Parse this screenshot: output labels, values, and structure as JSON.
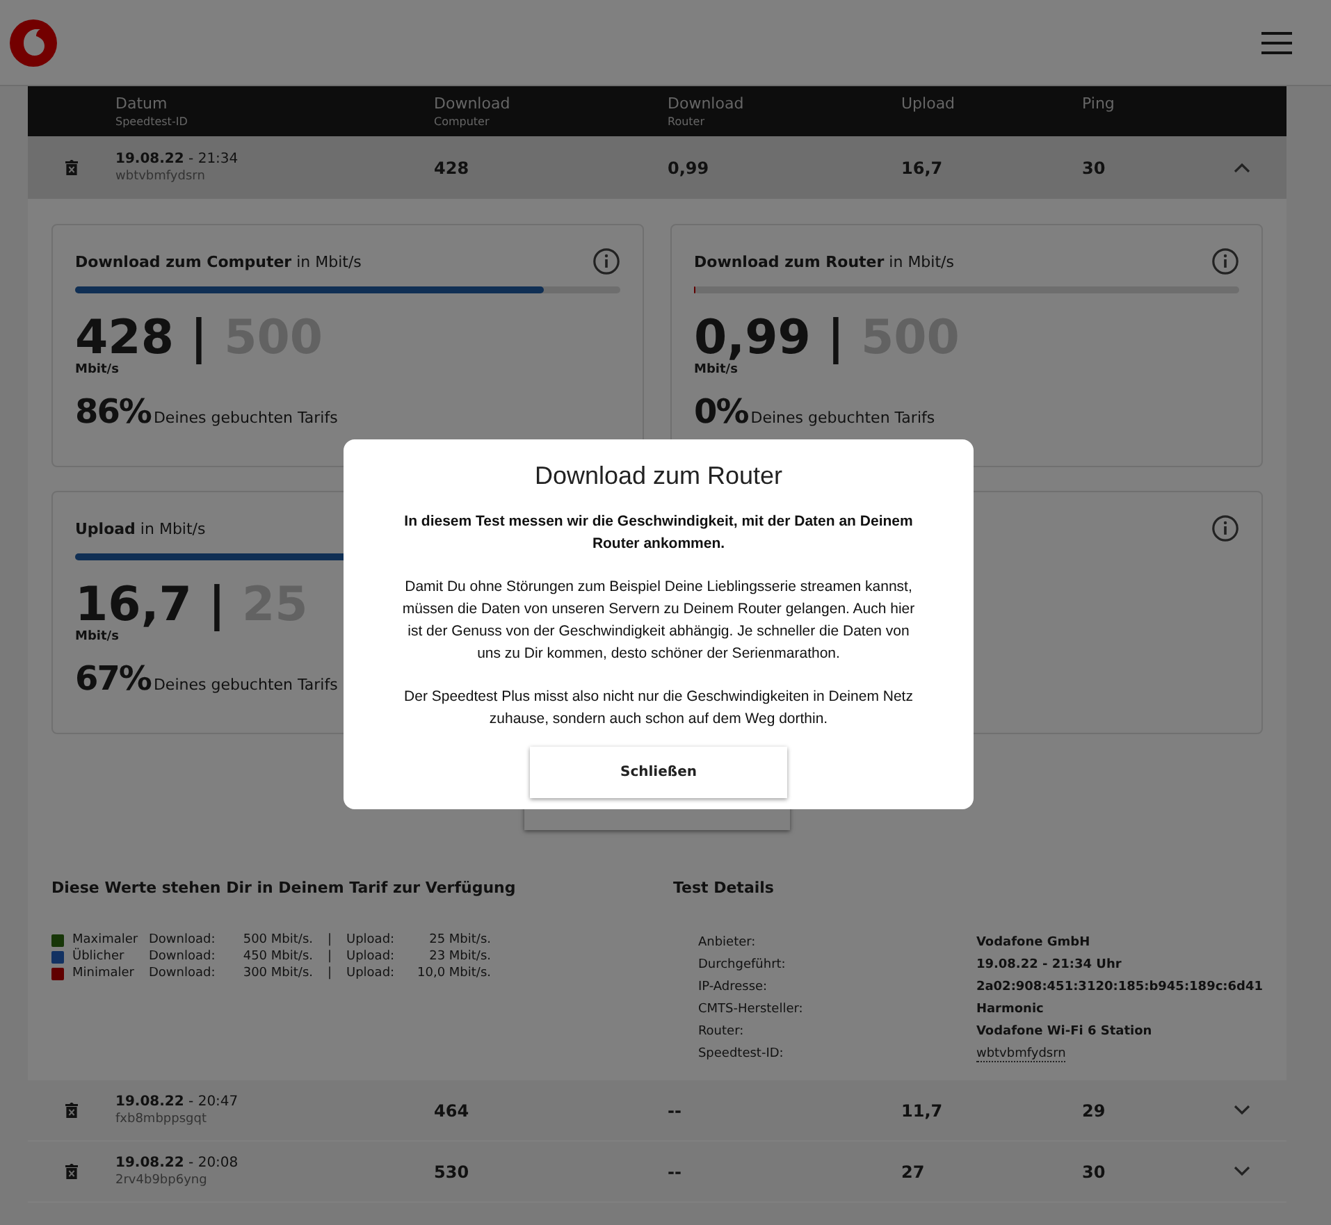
{
  "table": {
    "columns": [
      {
        "title": "Datum",
        "subtitle": "Speedtest-ID"
      },
      {
        "title": "Download",
        "subtitle": "Computer"
      },
      {
        "title": "Download",
        "subtitle": "Router"
      },
      {
        "title": "Upload"
      },
      {
        "title": "Ping"
      }
    ],
    "rows": [
      {
        "date": "19.08.22",
        "time": " - 21:34",
        "id": "wbtvbmfydsrn",
        "download_computer": "428",
        "download_router": "0,99",
        "upload": "16,7",
        "ping": "30",
        "expanded": true
      },
      {
        "date": "19.08.22",
        "time": " - 20:47",
        "id": "fxb8mbppsgqt",
        "download_computer": "464",
        "download_router": "--",
        "upload": "11,7",
        "ping": "29",
        "expanded": false
      },
      {
        "date": "19.08.22",
        "time": " - 20:08",
        "id": "2rv4b9bp6yng",
        "download_computer": "530",
        "download_router": "--",
        "upload": "27",
        "ping": "30",
        "expanded": false
      }
    ]
  },
  "cards": [
    {
      "title": "Download zum Computer",
      "unit_title": " in Mbit/s",
      "value": "428",
      "separator": " | ",
      "max": "500",
      "unit": "Mbit/s",
      "percent": "86%",
      "percent_label": "Deines gebuchten Tarifs",
      "level": 0.86,
      "color": "#102f54",
      "info": true
    },
    {
      "title": "Download zum Router",
      "unit_title": " in Mbit/s",
      "value": "0,99",
      "separator": " | ",
      "max": "500",
      "unit": "Mbit/s",
      "percent": "0%",
      "percent_label": "Deines gebuchten Tarifs",
      "level": 0.003,
      "color": "#600000",
      "info": true
    },
    {
      "title": "Upload",
      "unit_title": " in Mbit/s",
      "value": "16,7",
      "separator": " | ",
      "max": "25",
      "unit": "Mbit/s",
      "percent": "67%",
      "percent_label": "Deines gebuchten Tarifs",
      "level": 0.67,
      "color": "#102f54",
      "info": false
    },
    {
      "kind": "hidden",
      "info": true
    }
  ],
  "tariff": {
    "title": "Diese Werte stehen Dir in Deinem Tarif zur Verfügung",
    "items": [
      {
        "name": "Maximaler",
        "download_label": "Download:",
        "download": "500 Mbit/s.",
        "sep": "|",
        "upload_label": "Upload:",
        "upload": "25 Mbit/s.",
        "color": "#173608"
      },
      {
        "name": "Üblicher",
        "download_label": "Download:",
        "download": "450 Mbit/s.",
        "sep": "|",
        "upload_label": "Upload:",
        "upload": "23 Mbit/s.",
        "color": "#133262"
      },
      {
        "name": "Minimaler",
        "download_label": "Download:",
        "download": "300 Mbit/s.",
        "sep": "|",
        "upload_label": "Upload:",
        "upload": "10,0 Mbit/s.",
        "color": "#600000"
      }
    ]
  },
  "details": {
    "title": "Test Details",
    "items": [
      {
        "label": "Anbieter:",
        "value": "Vodafone GmbH",
        "kind": "text"
      },
      {
        "label": "Durchgeführt:",
        "value": "19.08.22 - 21:34 Uhr",
        "kind": "text"
      },
      {
        "label": "IP-Adresse:",
        "value": "2a02:908:451:3120:185:b945:189c:6d41",
        "kind": "text"
      },
      {
        "label": "CMTS-Hersteller:",
        "value": "Harmonic",
        "kind": "text"
      },
      {
        "label": "Router:",
        "value": "Vodafone Wi-Fi 6 Station",
        "kind": "text"
      },
      {
        "label": "Speedtest-ID:",
        "value": "wbtvbmfydsrn",
        "kind": "link"
      }
    ]
  },
  "modal": {
    "title": "Download zum Router",
    "intro": "In diesem Test messen wir die Geschwindigkeit, mit der Daten an Deinem Router ankommen.",
    "paragraphs": [
      "Damit Du ohne Störungen zum Beispiel Deine Lieblingsserie streamen kannst, müssen die Daten von unseren Servern zu Deinem Router gelangen. Auch hier ist der Genuss von der Geschwindigkeit abhängig. Je schneller die Daten von uns zu Dir kommen, desto schöner der Serienmarathon.",
      "Der Speedtest Plus misst also nicht nur die Geschwindigkeiten in Deinem Netz zuhause, sondern auch schon auf dem Weg dorthin."
    ],
    "button": "Schließen"
  }
}
